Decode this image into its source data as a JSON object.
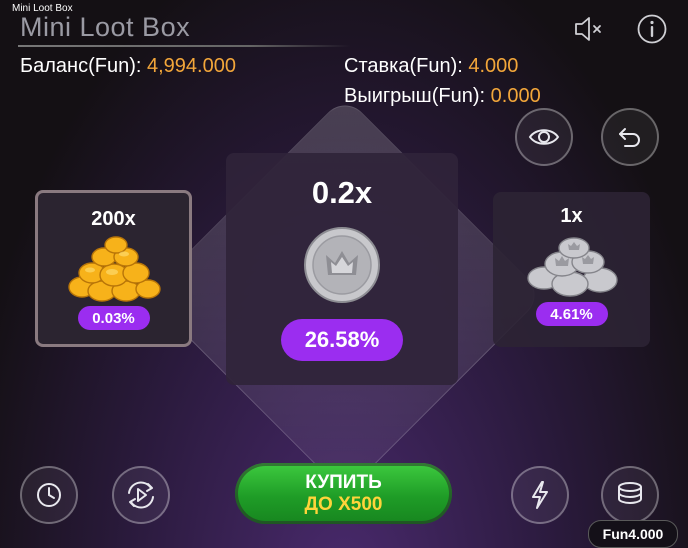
{
  "window": {
    "title": "Mini Loot Box"
  },
  "header": {
    "game_title": "Mini Loot Box"
  },
  "stats": {
    "balance_label": "Баланс(Fun):",
    "balance_value": "4,994.000",
    "bet_label": "Ставка(Fun):",
    "bet_value": "4.000",
    "win_label": "Выигрыш(Fun):",
    "win_value": "0.000"
  },
  "cards": [
    {
      "multiplier": "200x",
      "chance": "0.03%",
      "icon": "gold-coins-pile-icon"
    },
    {
      "multiplier": "0.2x",
      "chance": "26.58%",
      "icon": "silver-coin-icon"
    },
    {
      "multiplier": "1x",
      "chance": "4.61%",
      "icon": "silver-coins-stack-icon"
    }
  ],
  "buy_button": {
    "line1": "КУПИТЬ",
    "line2": "ДО X500"
  },
  "currency_badge": {
    "label": "Fun",
    "value": "4.000"
  },
  "colors": {
    "accent": "#f2a63a",
    "pill": "#9b2df0",
    "buy": "#2aaa30"
  }
}
